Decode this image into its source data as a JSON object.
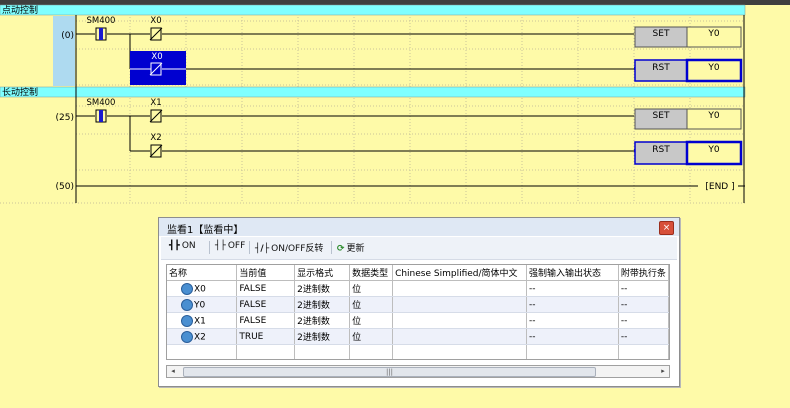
{
  "ladder": {
    "sections": [
      {
        "title": "点动控制"
      },
      {
        "title": "长动控制"
      }
    ],
    "step_numbers": [
      "(0)",
      "(25)",
      "(50)"
    ],
    "contacts": [
      "SM400",
      "X0",
      "X0",
      "SM400",
      "X1",
      "X2"
    ],
    "instructions": [
      {
        "op": "SET",
        "dev": "Y0"
      },
      {
        "op": "RST",
        "dev": "Y0"
      },
      {
        "op": "SET",
        "dev": "Y0"
      },
      {
        "op": "RST",
        "dev": "Y0"
      }
    ],
    "end": "[END ]"
  },
  "monitor": {
    "title": "监看1【监看中】",
    "toolbar": {
      "on": "ON",
      "off": "OFF",
      "toggle": "ON/OFF反转",
      "refresh": "更新"
    },
    "columns": [
      "名称",
      "当前值",
      "显示格式",
      "数据类型",
      "Chinese Simplified/简体中文",
      "强制输入输出状态",
      "附带执行条"
    ],
    "rows": [
      {
        "name": "X0",
        "value": "FALSE",
        "format": "2进制数",
        "type": "位",
        "comment": "",
        "force": "--",
        "cond": "--"
      },
      {
        "name": "Y0",
        "value": "FALSE",
        "format": "2进制数",
        "type": "位",
        "comment": "",
        "force": "--",
        "cond": "--"
      },
      {
        "name": "X1",
        "value": "FALSE",
        "format": "2进制数",
        "type": "位",
        "comment": "",
        "force": "--",
        "cond": "--"
      },
      {
        "name": "X2",
        "value": "TRUE",
        "format": "2进制数",
        "type": "位",
        "comment": "",
        "force": "--",
        "cond": "--"
      }
    ]
  },
  "colors": {
    "background": "#fefaa8",
    "section_bar": "#7fffff",
    "selection": "#0000d0",
    "step_column": "#aedaf0",
    "coil_box": "#c8c8c8"
  }
}
